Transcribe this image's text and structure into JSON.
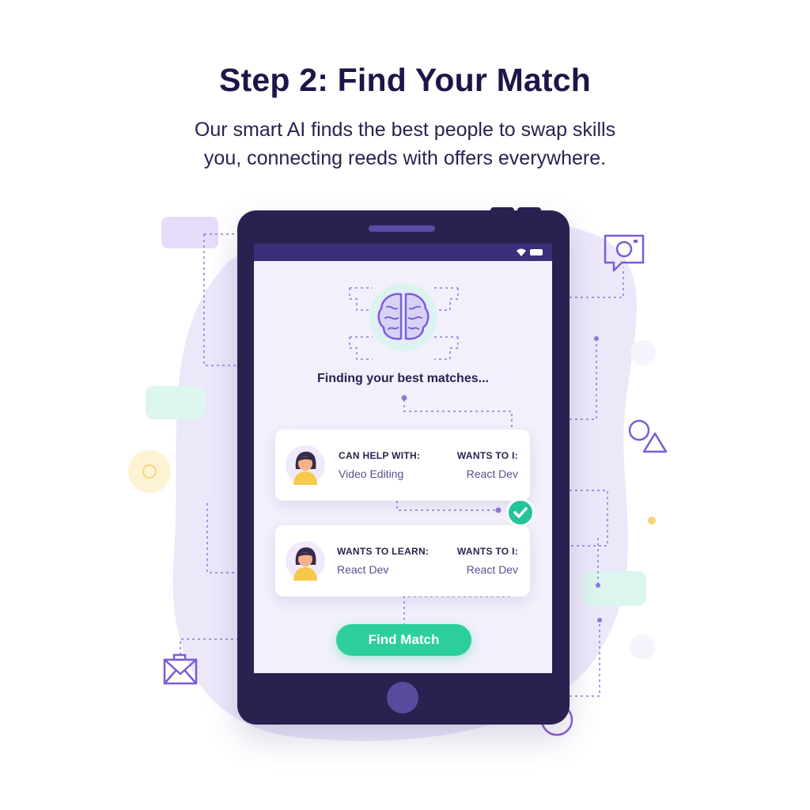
{
  "header": {
    "title": "Step 2: Find Your Match",
    "subtitle_line1": "Our smart AI finds the best people to swap skills",
    "subtitle_line2": "you, connecting reeds with offers everywhere."
  },
  "screen": {
    "status_text": "Finding your best matches...",
    "cards": [
      {
        "left_label": "CAN HELP WITH:",
        "left_value": "Video Editing",
        "right_label": "WANTS TO I:",
        "right_value": "React Dev"
      },
      {
        "left_label": "WANTS TO LEARN:",
        "left_value": "React Dev",
        "right_label": "WANTS TO I:",
        "right_value": "React Dev"
      }
    ],
    "action_button": "Find Match"
  },
  "icons": [
    "brain-icon",
    "avatar-icon",
    "check-icon",
    "wifi-icon",
    "battery-icon",
    "chat-camera-icon",
    "envelope-icon",
    "circle-triangle-icon"
  ],
  "colors": {
    "accent": "#2ccf9c",
    "device": "#2a2150",
    "brand_purple": "#7a5cd6",
    "text_dark": "#1f1547"
  }
}
